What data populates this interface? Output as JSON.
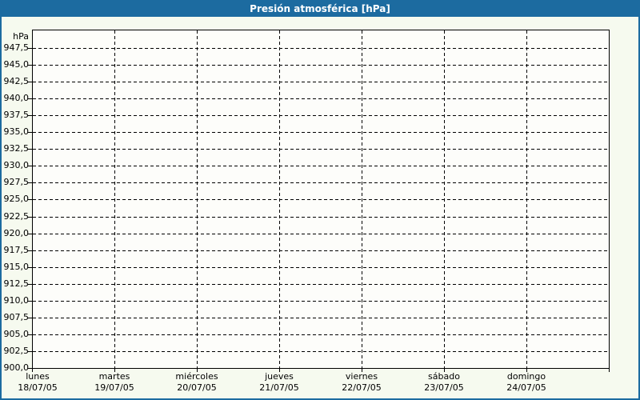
{
  "window": {
    "title": "Presión atmosférica [hPa]"
  },
  "colors": {
    "titlebar_bg": "#1c6ba0",
    "frame_border": "#1c6ba0",
    "title_text": "#ffffff",
    "page_bg": "#f6faef",
    "plot_bg": "#fdfdfa",
    "grid": "#000000",
    "text": "#000000"
  },
  "chart_data": {
    "type": "line",
    "title": "Presión atmosférica [hPa]",
    "y_unit": "hPa",
    "xlabel": "",
    "ylabel": "hPa",
    "ylim": [
      900,
      950
    ],
    "ytick_step": 2.5,
    "ytick_values": [
      947.5,
      945.0,
      942.5,
      940.0,
      937.5,
      935.0,
      932.5,
      930.0,
      927.5,
      925.0,
      922.5,
      920.0,
      917.5,
      915.0,
      912.5,
      910.0,
      907.5,
      905.0,
      902.5,
      900.0
    ],
    "ytick_labels": [
      "947,5",
      "945,0",
      "942,5",
      "940,0",
      "937,5",
      "935,0",
      "932,5",
      "930,0",
      "927,5",
      "925,0",
      "922,5",
      "920,0",
      "917,5",
      "915,0",
      "912,5",
      "910,0",
      "907,5",
      "905,0",
      "902,5",
      "900,0"
    ],
    "x_days": [
      {
        "day": "lunes",
        "date": "18/07/05"
      },
      {
        "day": "martes",
        "date": "19/07/05"
      },
      {
        "day": "miércoles",
        "date": "20/07/05"
      },
      {
        "day": "jueves",
        "date": "21/07/05"
      },
      {
        "day": "viernes",
        "date": "22/07/05"
      },
      {
        "day": "sábado",
        "date": "23/07/05"
      },
      {
        "day": "domingo",
        "date": "24/07/05"
      }
    ],
    "series": [],
    "grid": {
      "horizontal": "dashed",
      "vertical": "dashed"
    },
    "legend": "none"
  }
}
